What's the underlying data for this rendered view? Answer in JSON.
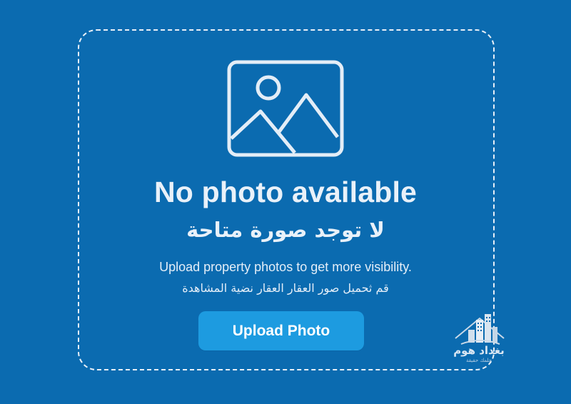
{
  "colors": {
    "background": "#0b6bb0",
    "accent_button": "#1d9be0",
    "foreground": "#e9f1f9"
  },
  "placeholder": {
    "icon": "image-placeholder-icon",
    "title": "No photo available",
    "title_ar": "لا توجد صورة متاحة",
    "subtitle": "Upload property photos to get more visibility.",
    "subtitle_ar": "قم ثحميل صور العقار العقار نضية المشاهدة"
  },
  "upload_button": {
    "label": "Upload Photo"
  },
  "brand": {
    "icon": "buildings-logo-icon",
    "name_ar": "بغداد هوم",
    "tagline_ar": "حلمك حقيقة"
  }
}
